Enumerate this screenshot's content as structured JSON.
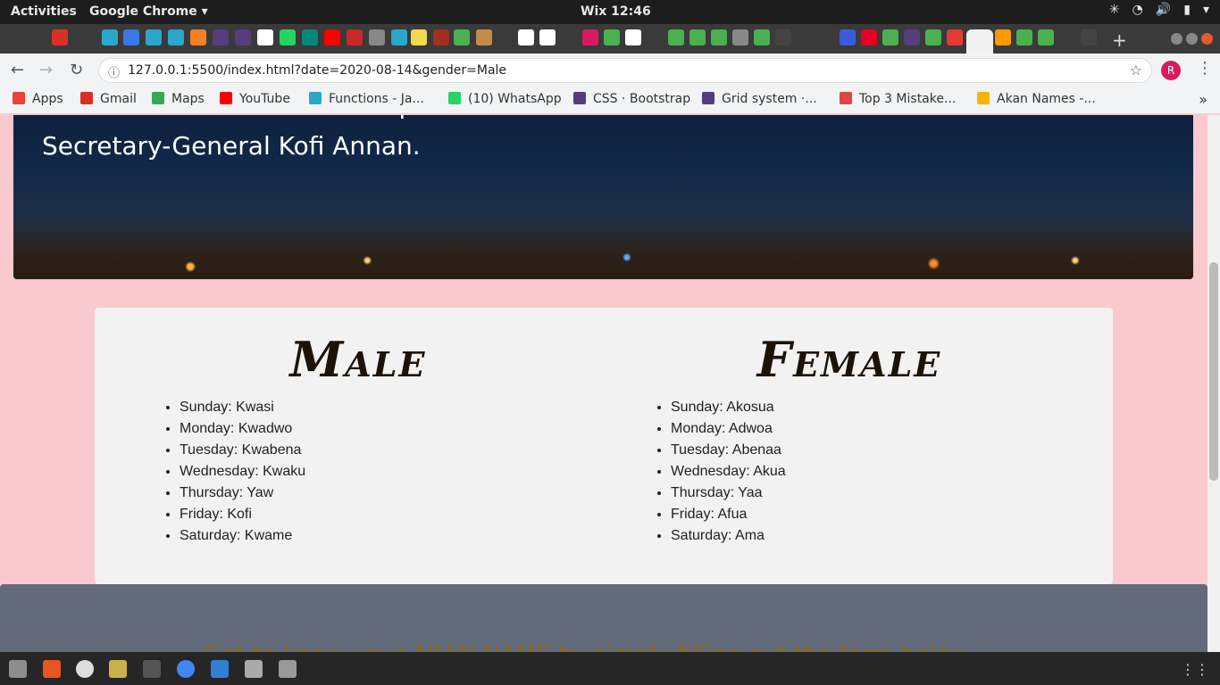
{
  "system": {
    "activities": "Activities",
    "app": "Google Chrome ▾",
    "clock": "Wix 12:46"
  },
  "browser": {
    "url": "127.0.0.1:5500/index.html?date=2020-08-14&gender=Male",
    "avatar": "R"
  },
  "bookmarks": [
    {
      "label": "Apps",
      "color": "#ea4335"
    },
    {
      "label": "Gmail",
      "color": "#d93025"
    },
    {
      "label": "Maps",
      "color": "#34a853"
    },
    {
      "label": "YouTube",
      "color": "#ff0000"
    },
    {
      "label": "Functions - Ja...",
      "color": "#2aa7c9"
    },
    {
      "label": "(10) WhatsApp",
      "color": "#25d366"
    },
    {
      "label": "CSS · Bootstrap",
      "color": "#563d7c"
    },
    {
      "label": "Grid system ·...",
      "color": "#563d7c"
    },
    {
      "label": "Top 3 Mistake...",
      "color": "#e04545"
    },
    {
      "label": "Akan Names -...",
      "color": "#f4b400"
    }
  ],
  "hero": {
    "text": "names include Ghana's first president Kwame Nkrumah and former United Nations Secretary-General Kofi Annan."
  },
  "male": {
    "title": "Male",
    "items": [
      "Sunday: Kwasi",
      "Monday: Kwadwo",
      "Tuesday: Kwabena",
      "Wednesday: Kwaku",
      "Thursday: Yaw",
      "Friday: Kofi",
      "Saturday: Kwame"
    ]
  },
  "female": {
    "title": "Female",
    "items": [
      "Sunday: Akosua",
      "Monday: Adwoa",
      "Tuesday: Abenaa",
      "Wednesday: Akua",
      "Thursday: Yaa",
      "Friday: Afua",
      "Saturday: Ama"
    ]
  },
  "footer": {
    "text": "Get to know your AKAN NAME by simply filling out the form below"
  }
}
